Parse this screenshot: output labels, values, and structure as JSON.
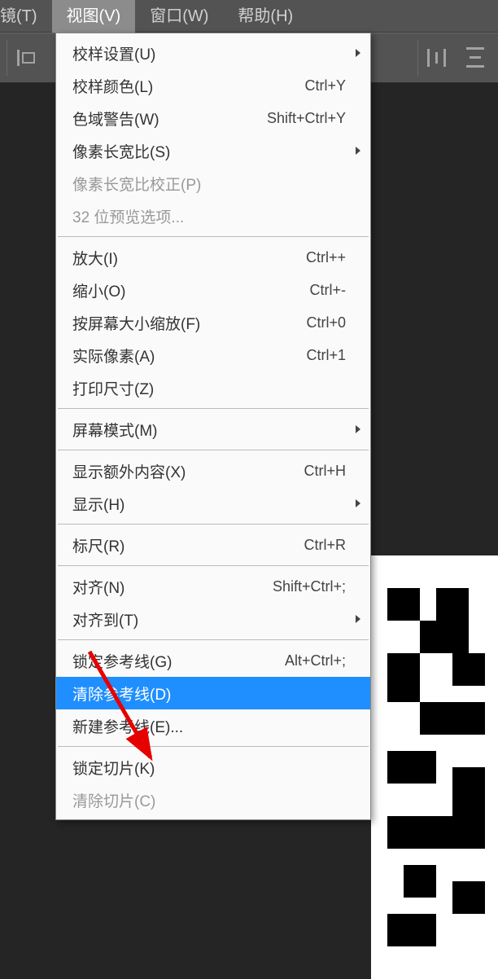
{
  "menubar": {
    "items": [
      {
        "label": "镜(T)"
      },
      {
        "label": "视图(V)"
      },
      {
        "label": "窗口(W)"
      },
      {
        "label": "帮助(H)"
      }
    ],
    "activeIndex": 1
  },
  "dropdown": {
    "groups": [
      [
        {
          "label": "校样设置(U)",
          "shortcut": "",
          "submenu": true,
          "disabled": false
        },
        {
          "label": "校样颜色(L)",
          "shortcut": "Ctrl+Y",
          "submenu": false,
          "disabled": false
        },
        {
          "label": "色域警告(W)",
          "shortcut": "Shift+Ctrl+Y",
          "submenu": false,
          "disabled": false
        },
        {
          "label": "像素长宽比(S)",
          "shortcut": "",
          "submenu": true,
          "disabled": false
        },
        {
          "label": "像素长宽比校正(P)",
          "shortcut": "",
          "submenu": false,
          "disabled": true
        },
        {
          "label": "32 位预览选项...",
          "shortcut": "",
          "submenu": false,
          "disabled": true
        }
      ],
      [
        {
          "label": "放大(I)",
          "shortcut": "Ctrl++",
          "submenu": false,
          "disabled": false
        },
        {
          "label": "缩小(O)",
          "shortcut": "Ctrl+-",
          "submenu": false,
          "disabled": false
        },
        {
          "label": "按屏幕大小缩放(F)",
          "shortcut": "Ctrl+0",
          "submenu": false,
          "disabled": false
        },
        {
          "label": "实际像素(A)",
          "shortcut": "Ctrl+1",
          "submenu": false,
          "disabled": false
        },
        {
          "label": "打印尺寸(Z)",
          "shortcut": "",
          "submenu": false,
          "disabled": false
        }
      ],
      [
        {
          "label": "屏幕模式(M)",
          "shortcut": "",
          "submenu": true,
          "disabled": false
        }
      ],
      [
        {
          "label": "显示额外内容(X)",
          "shortcut": "Ctrl+H",
          "submenu": false,
          "disabled": false
        },
        {
          "label": "显示(H)",
          "shortcut": "",
          "submenu": true,
          "disabled": false
        }
      ],
      [
        {
          "label": "标尺(R)",
          "shortcut": "Ctrl+R",
          "submenu": false,
          "disabled": false
        }
      ],
      [
        {
          "label": "对齐(N)",
          "shortcut": "Shift+Ctrl+;",
          "submenu": false,
          "disabled": false
        },
        {
          "label": "对齐到(T)",
          "shortcut": "",
          "submenu": true,
          "disabled": false
        }
      ],
      [
        {
          "label": "锁定参考线(G)",
          "shortcut": "Alt+Ctrl+;",
          "submenu": false,
          "disabled": false
        },
        {
          "label": "清除参考线(D)",
          "shortcut": "",
          "submenu": false,
          "disabled": false,
          "highlighted": true
        },
        {
          "label": "新建参考线(E)...",
          "shortcut": "",
          "submenu": false,
          "disabled": false
        }
      ],
      [
        {
          "label": "锁定切片(K)",
          "shortcut": "",
          "submenu": false,
          "disabled": false
        },
        {
          "label": "清除切片(C)",
          "shortcut": "",
          "submenu": false,
          "disabled": true
        }
      ]
    ]
  }
}
